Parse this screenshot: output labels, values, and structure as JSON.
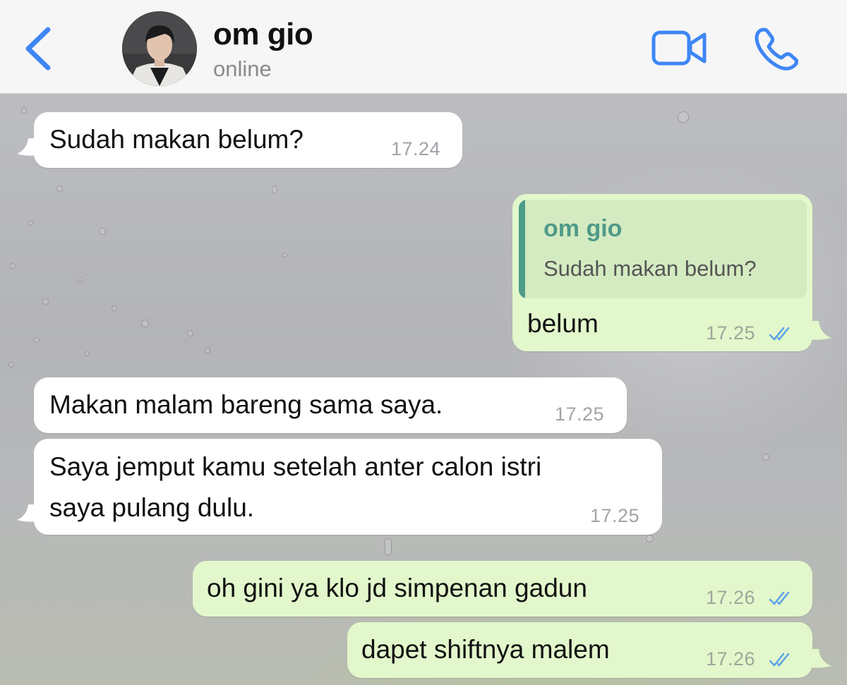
{
  "header": {
    "contact_name": "om gio",
    "status": "online",
    "back_icon": "chevron-left-icon",
    "video_icon": "video-camera-icon",
    "call_icon": "phone-icon",
    "accent_color": "#3e86f5"
  },
  "messages": [
    {
      "direction": "in",
      "text": "Sudah makan belum?",
      "time": "17.24"
    },
    {
      "direction": "out",
      "quote_name": "om gio",
      "quote_text": "Sudah makan belum?",
      "text": "belum",
      "time": "17.25",
      "status": "read"
    },
    {
      "direction": "in",
      "text": "Makan malam bareng sama saya.",
      "time": "17.25"
    },
    {
      "direction": "in",
      "text_line1": "Saya jemput kamu setelah anter calon istri",
      "text_line2": "saya pulang dulu.",
      "time": "17.25"
    },
    {
      "direction": "out",
      "text": "oh gini ya klo jd simpenan gadun",
      "time": "17.26",
      "status": "read"
    },
    {
      "direction": "out",
      "text": "dapet shiftnya malem",
      "time": "17.26",
      "status": "read"
    }
  ],
  "colors": {
    "incoming_bubble": "#ffffff",
    "outgoing_bubble": "#e2f7cb",
    "quote_accent": "#4d9b89",
    "read_ticks": "#5aa3e8"
  }
}
